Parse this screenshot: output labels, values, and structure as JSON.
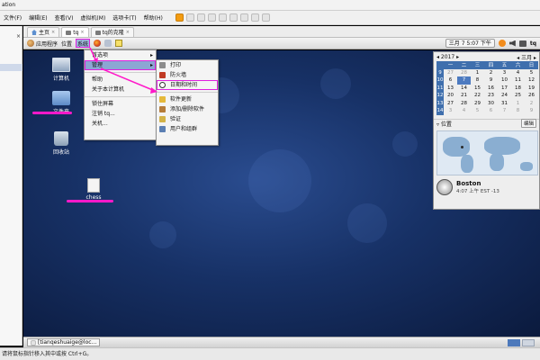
{
  "host": {
    "title": "ation",
    "menus": [
      "文件(F)",
      "编辑(E)",
      "查看(V)",
      "虚拟机(M)",
      "选项卡(T)",
      "帮助(H)"
    ],
    "status": "请将鼠标指针移入其中或按 Ctrl+G。"
  },
  "vm_tabs": [
    {
      "label": "主页"
    },
    {
      "label": "tq"
    },
    {
      "label": "tq的克隆"
    }
  ],
  "panel": {
    "applications": "应用程序",
    "places": "位置",
    "system": "系统",
    "date": "三月",
    "day": "7",
    "time": "5:07 下午",
    "user": "tq"
  },
  "desktop": {
    "computer": "计算机",
    "home": "文件夹",
    "trash": "回收站",
    "file": "chess"
  },
  "system_menu": {
    "items": [
      "首选项",
      "管理",
      "帮助",
      "关于本计算机",
      "锁住屏幕",
      "注销 tq...",
      "关机..."
    ]
  },
  "admin_menu": {
    "items": [
      "打印",
      "防火墙",
      "日期和时间",
      "软件更新",
      "添加/删除软件",
      "验证",
      "用户和组群"
    ]
  },
  "calendar": {
    "year": "2017",
    "month": "三月",
    "dow": [
      "",
      "一",
      "二",
      "三",
      "四",
      "五",
      "六",
      "日"
    ],
    "weeks": [
      [
        "9",
        "27",
        "28",
        "1",
        "2",
        "3",
        "4",
        "5"
      ],
      [
        "10",
        "6",
        "7",
        "8",
        "9",
        "10",
        "11",
        "12"
      ],
      [
        "11",
        "13",
        "14",
        "15",
        "16",
        "17",
        "18",
        "19"
      ],
      [
        "12",
        "20",
        "21",
        "22",
        "23",
        "24",
        "25",
        "26"
      ],
      [
        "13",
        "27",
        "28",
        "29",
        "30",
        "31",
        "1",
        "2"
      ],
      [
        "14",
        "3",
        "4",
        "5",
        "6",
        "7",
        "8",
        "9"
      ]
    ],
    "locations_label": "位置",
    "edit": "编辑",
    "city": "Boston",
    "city_time": "4:07 上午   EST -13"
  },
  "taskbar": {
    "window": "[tianqeshuaige@loc..."
  },
  "colors": {
    "accent_blue": "#3f6fad",
    "highlight_magenta": "#e020e0",
    "annotation_pink": "#ff19c9"
  }
}
